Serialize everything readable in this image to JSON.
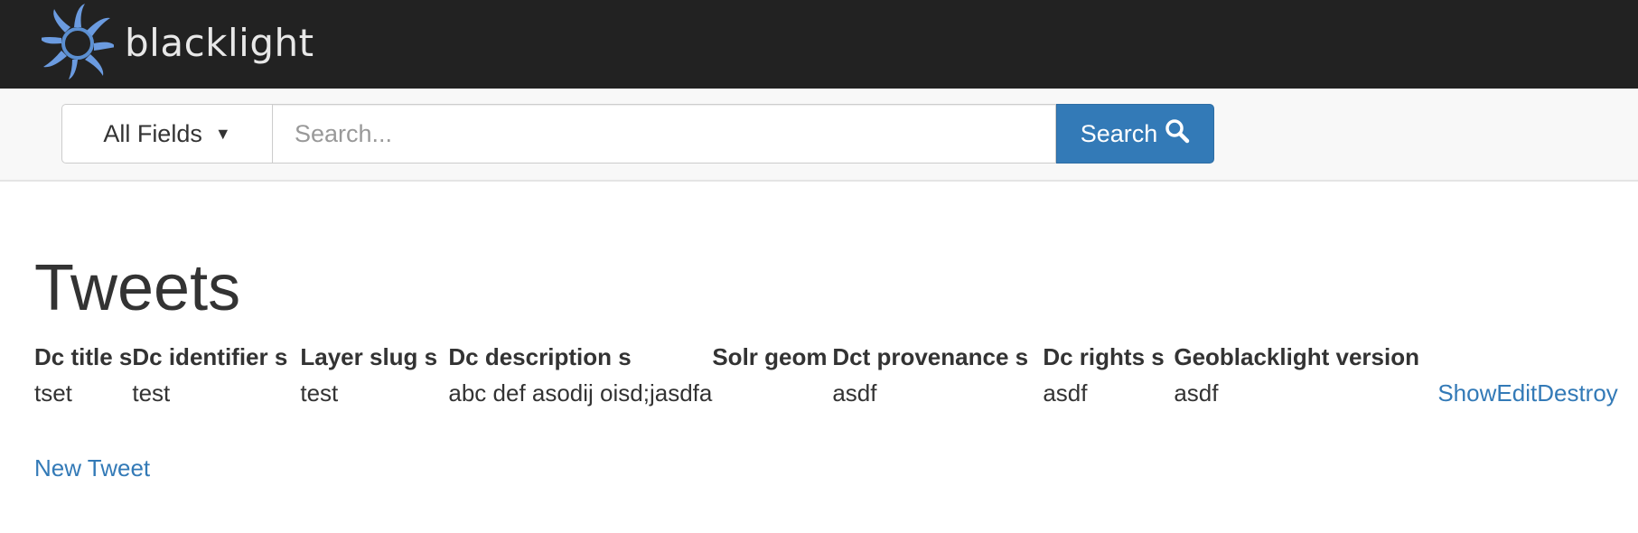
{
  "brand": {
    "name": "blacklight"
  },
  "search": {
    "field_selected": "All Fields",
    "placeholder": "Search...",
    "button_label": "Search"
  },
  "page": {
    "title": "Tweets",
    "new_link": "New Tweet"
  },
  "table": {
    "headers": [
      "Dc title s",
      "Dc identifier s",
      "Layer slug s",
      "Dc description s",
      "Solr geom",
      "Dct provenance s",
      "Dc rights s",
      "Geoblacklight version"
    ],
    "rows": [
      {
        "cells": [
          "tset",
          "test",
          "test",
          "abc def asodij oisd;jasdfa",
          "",
          "asdf",
          "asdf",
          "asdf"
        ],
        "actions": [
          "Show",
          "Edit",
          "Destroy"
        ]
      }
    ]
  },
  "colors": {
    "topbar": "#222222",
    "accent": "#337ab7",
    "link": "#337ab7"
  },
  "icons": {
    "logo": "sun-logo-icon",
    "search": "search-icon",
    "caret": "caret-down-icon"
  }
}
